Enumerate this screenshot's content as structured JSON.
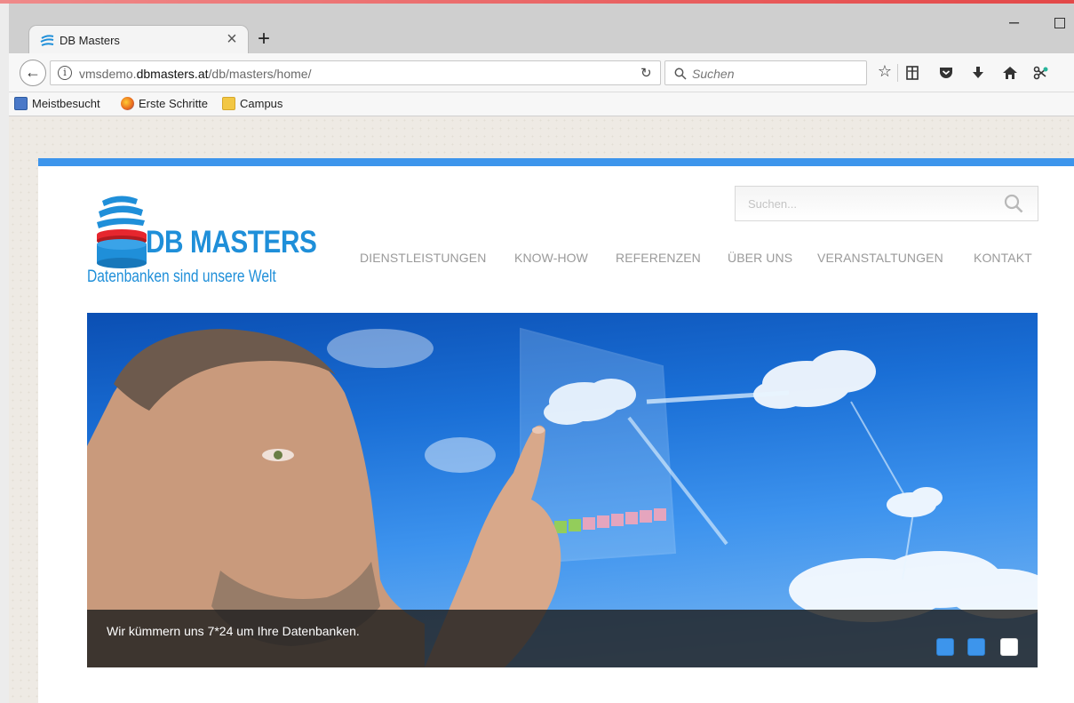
{
  "browser": {
    "tab_title": "DB Masters",
    "tab_close": "×",
    "new_tab": "+",
    "min": "–",
    "url_prefix": "vmsdemo.",
    "url_domain": "dbmasters.at",
    "url_path": "/db/masters/home/",
    "search_placeholder": "Suchen",
    "bookmarks": [
      "Meistbesucht",
      "Erste Schritte",
      "Campus"
    ]
  },
  "site": {
    "logo_text": "DB MASTERS",
    "logo_tagline": "Datenbanken sind unsere Welt",
    "search_placeholder": "Suchen...",
    "nav": [
      "DIENSTLEISTUNGEN",
      "KNOW-HOW",
      "REFERENZEN",
      "ÜBER UNS",
      "VERANSTALTUNGEN",
      "KONTAKT"
    ],
    "hero_caption": "Wir kümmern uns 7*24 um Ihre Datenbanken.",
    "slider_active_index": 2
  },
  "colors": {
    "brand_blue": "#1f8fd9",
    "topbar_blue": "#3d95ec",
    "logo_red": "#e6262e",
    "nav_grey": "#9a9a9a"
  }
}
